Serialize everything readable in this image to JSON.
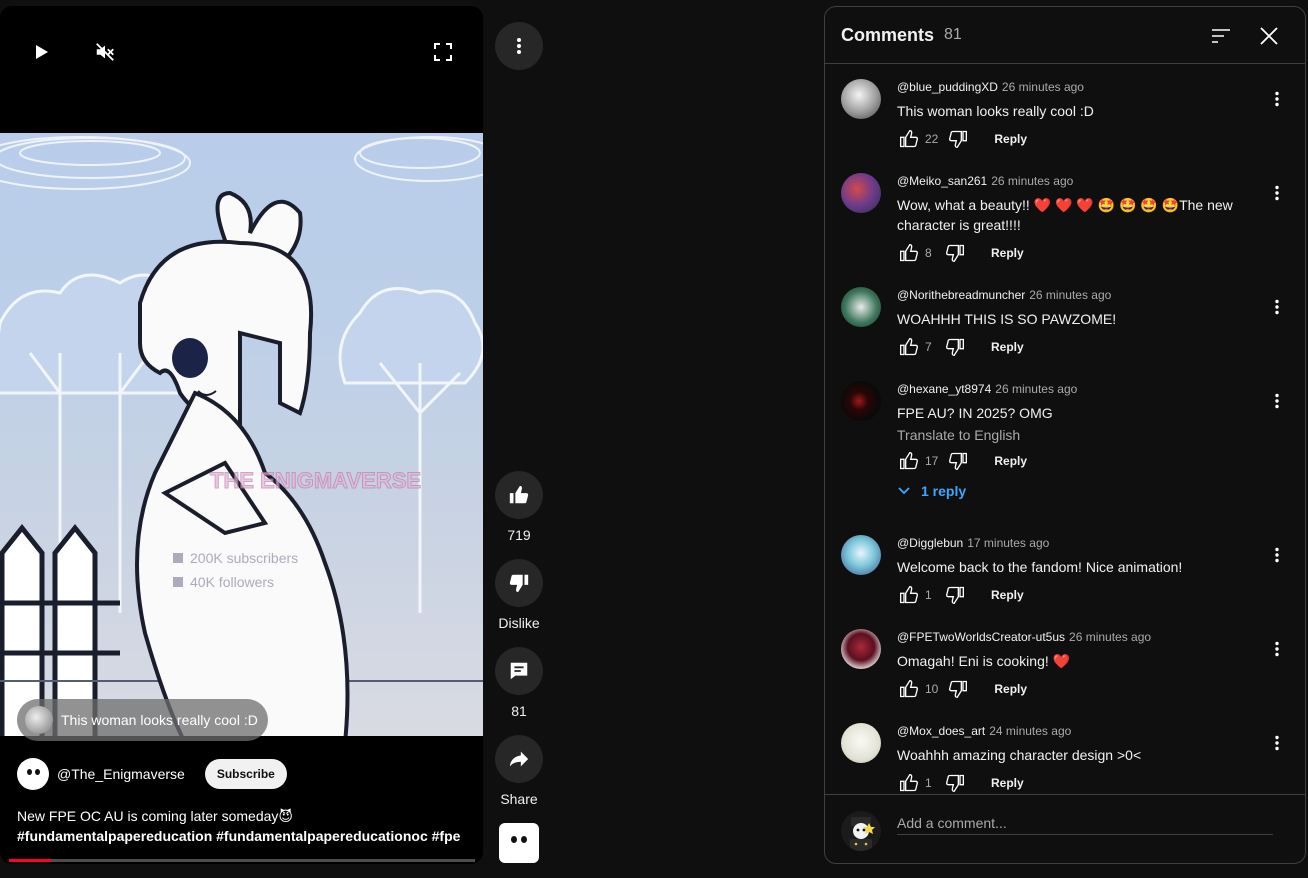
{
  "player": {
    "play_icon": "play-icon",
    "mute_icon": "muted-speaker-icon",
    "fullscreen_icon": "fullscreen-icon",
    "watermark": {
      "title": "THE ENIGMAVERSE",
      "line1": "200K subscribers",
      "line2": "40K followers"
    },
    "overlay_comment": "This woman looks really cool :D",
    "channel_handle": "@The_Enigmaverse",
    "subscribe_label": "Subscribe",
    "description": "New FPE OC AU is coming later someday😈",
    "hashtags": "#fundamentalpapereducation #fundamentalpapereducationoc #fpe",
    "progress": 0.09,
    "progress_color": "#ff0033"
  },
  "actions": {
    "like_count": "719",
    "dislike_label": "Dislike",
    "comment_count": "81",
    "share_label": "Share"
  },
  "comments_panel": {
    "title": "Comments",
    "count": "81",
    "add_placeholder": "Add a comment...",
    "reply_label": "Reply",
    "translate_label": "Translate to English",
    "replies_label": "1 reply",
    "items": [
      {
        "author": "@blue_puddingXD",
        "time": "26 minutes ago",
        "text": "This woman looks really cool :D",
        "likes": "22"
      },
      {
        "author": "@Meiko_san261",
        "time": "26 minutes ago",
        "text": "Wow, what a beauty!! ❤️ ❤️ ❤️ 🤩 🤩 🤩 🤩The new character is great!!!!",
        "likes": "8"
      },
      {
        "author": "@Norithebreadmuncher",
        "time": "26 minutes ago",
        "text": "WOAHHH THIS IS SO PAWZOME!",
        "likes": "7"
      },
      {
        "author": "@hexane_yt8974",
        "time": "26 minutes ago",
        "text": "FPE AU? IN 2025? OMG",
        "likes": "17"
      },
      {
        "author": "@Digglebun",
        "time": "17 minutes ago",
        "text": "Welcome back to the fandom! Nice animation!",
        "likes": "1"
      },
      {
        "author": "@FPETwoWorldsCreator-ut5us",
        "time": "26 minutes ago",
        "text": "Omagah! Eni is cooking! ❤️",
        "likes": "10"
      },
      {
        "author": "@Mox_does_art",
        "time": "24 minutes ago",
        "text": "Woahhh amazing character design >0<",
        "likes": "1"
      }
    ]
  },
  "colors": {
    "background": "#0f0f0f",
    "accent_link": "#3ea6ff",
    "button_bg": "#272727"
  }
}
